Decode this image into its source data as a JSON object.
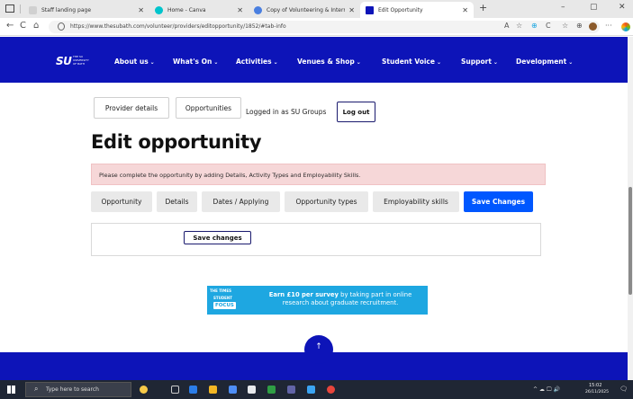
{
  "browser": {
    "tabs": [
      {
        "title": "Staff landing page",
        "active": false
      },
      {
        "title": "Home - Canva",
        "active": false
      },
      {
        "title": "Copy of Volunteering & Internati",
        "active": false
      },
      {
        "title": "Edit Opportunity",
        "active": true
      }
    ],
    "new_tab": "+",
    "window_controls": {
      "minimize": "–",
      "restore": "▢",
      "close": "✕"
    },
    "url": "https://www.thesubath.com/volunteer/providers/editopportunity/1852/#tab-info",
    "toolbar": {
      "back": "←",
      "reload": "C",
      "home": "⌂",
      "read_aloud": "A",
      "favorite": "☆",
      "collections": "⊕",
      "more": "···"
    }
  },
  "site": {
    "logo": "SU",
    "logo_sub": "THE SU UNIVERSITY OF BATH",
    "nav": [
      {
        "label": "About us",
        "chevron": "⌄"
      },
      {
        "label": "What's On",
        "chevron": "⌄"
      },
      {
        "label": "Activities",
        "chevron": "⌄"
      },
      {
        "label": "Venues & Shop",
        "chevron": "⌄"
      },
      {
        "label": "Student Voice",
        "chevron": "⌄"
      },
      {
        "label": "Support",
        "chevron": "⌄"
      },
      {
        "label": "Development",
        "chevron": "⌄"
      }
    ]
  },
  "account": {
    "provider_details": "Provider details",
    "opportunities": "Opportunities",
    "logged_in": "Logged in as SU Groups",
    "logout": "Log out"
  },
  "page": {
    "title": "Edit opportunity",
    "notice": "Please complete the opportunity by adding Details, Activity Types and Employability Skills.",
    "tabs": [
      "Opportunity",
      "Details",
      "Dates / Applying",
      "Opportunity types",
      "Employability skills"
    ],
    "save_tab": "Save Changes",
    "save_button": "Save changes"
  },
  "banner": {
    "logo_top": "THE TIMES",
    "logo_mid": "STUDENT",
    "logo_focus": "FOCUS",
    "text_bold": "Earn £10 per survey",
    "text_rest": " by taking part in online research about graduate recruitment."
  },
  "back_to_top": "↑",
  "taskbar": {
    "search_placeholder": "Type here to search",
    "search_icon": "⌕",
    "tray": "^ ☁ 🖵 🔊",
    "time": "15:02",
    "date": "26/11/2025",
    "notifications": "🗨"
  },
  "colors": {
    "brand_blue": "#0d14b8",
    "save_blue": "#0057ff",
    "notice_bg": "#f6d7d8",
    "banner_blue": "#1ea7e1"
  }
}
